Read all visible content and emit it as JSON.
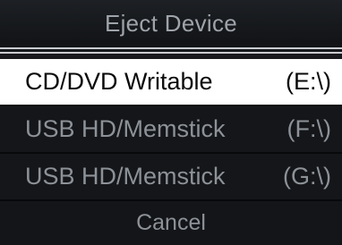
{
  "dialog": {
    "title": "Eject Device",
    "items": [
      {
        "label": "CD/DVD Writable",
        "drive": "(E:\\)",
        "selected": true
      },
      {
        "label": "USB HD/Memstick",
        "drive": "(F:\\)",
        "selected": false
      },
      {
        "label": "USB HD/Memstick",
        "drive": "(G:\\)",
        "selected": false
      }
    ],
    "cancel_label": "Cancel"
  },
  "colors": {
    "background": "#17191c",
    "selected_background": "#ffffff",
    "text": "#8d9298",
    "selected_text": "#0a0a0a"
  }
}
